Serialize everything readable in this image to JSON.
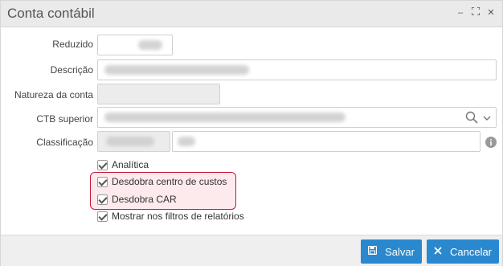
{
  "window": {
    "title": "Conta contábil",
    "controls": {
      "minimize": "‒",
      "restore": "⛶",
      "close": "✕"
    }
  },
  "form": {
    "reduzido_label": "Reduzido",
    "descricao_label": "Descrição",
    "natureza_label": "Natureza da conta",
    "ctb_superior_label": "CTB superior",
    "classificacao_label": "Classificação"
  },
  "checkboxes": [
    {
      "label": "Analítica",
      "checked": true
    },
    {
      "label": "Desdobra centro de custos",
      "checked": true
    },
    {
      "label": "Desdobra CAR",
      "checked": true
    },
    {
      "label": "Mostrar nos filtros de relatórios",
      "checked": true
    }
  ],
  "footer": {
    "save_label": "Salvar",
    "cancel_label": "Cancelar"
  },
  "icons": {
    "save": "floppy-icon",
    "cancel": "close-icon",
    "search": "search-icon",
    "dropdown": "chevron-down-icon",
    "info": "info-icon"
  },
  "colors": {
    "accent": "#2a88cf",
    "highlight_border": "#c8163a",
    "titlebar_bg": "#eaeaea"
  }
}
